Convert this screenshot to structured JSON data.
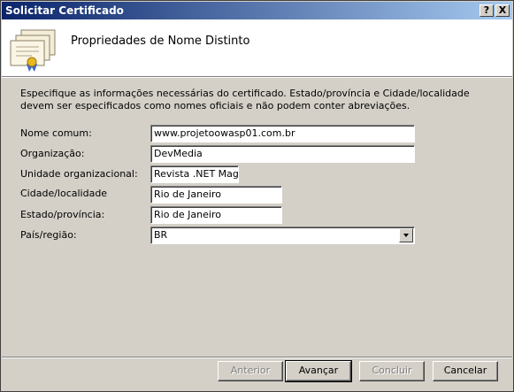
{
  "window": {
    "title": "Solicitar Certificado",
    "help_glyph": "?",
    "close_glyph": "X"
  },
  "header": {
    "title": "Propriedades de Nome Distinto",
    "icon": "certificate-icon"
  },
  "description": "Especifique as informações necessárias do certificado. Estado/província e Cidade/localidade devem ser especificados como nomes oficiais e não podem conter abreviações.",
  "fields": {
    "nome_comum": {
      "label": "Nome comum:",
      "value": "www.projetoowasp01.com.br"
    },
    "organizacao": {
      "label": "Organização:",
      "value": "DevMedia"
    },
    "unidade": {
      "label": "Unidade organizacional:",
      "value": "Revista .NET Magaz"
    },
    "cidade": {
      "label": "Cidade/localidade",
      "value": "Rio de Janeiro"
    },
    "estado": {
      "label": "Estado/província:",
      "value": "Rio de Janeiro"
    },
    "pais": {
      "label": "País/região:",
      "value": "BR"
    }
  },
  "buttons": {
    "anterior": "Anterior",
    "avancar": "Avançar",
    "concluir": "Concluir",
    "cancelar": "Cancelar"
  }
}
